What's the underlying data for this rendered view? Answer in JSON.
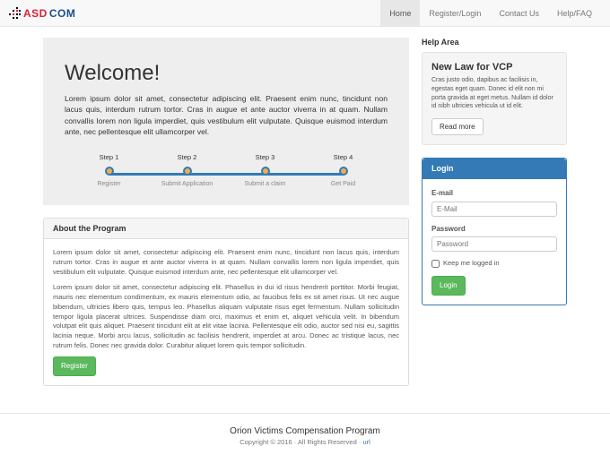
{
  "brand": {
    "part1": "ASD",
    "part2": "COM"
  },
  "nav": {
    "items": [
      {
        "label": "Home",
        "active": true
      },
      {
        "label": "Register/Login",
        "active": false
      },
      {
        "label": "Contact Us",
        "active": false
      },
      {
        "label": "Help/FAQ",
        "active": false
      }
    ]
  },
  "jumbo": {
    "title": "Welcome!",
    "body": "Lorem ipsum dolor sit amet, consectetur adipiscing elit. Praesent enim nunc, tincidunt non lacus quis, interdum rutrum tortor. Cras in augue et ante auctor viverra in at quam. Nullam convallis lorem non ligula imperdiet, quis vestibulum elit vulputate. Quisque euismod interdum ante, nec pellentesque elit ullamcorper vel."
  },
  "steps": [
    {
      "top": "Step 1",
      "bottom": "Register"
    },
    {
      "top": "Step 2",
      "bottom": "Submit Application"
    },
    {
      "top": "Step 3",
      "bottom": "Submit a claim"
    },
    {
      "top": "Step 4",
      "bottom": "Get Paid"
    }
  ],
  "about": {
    "heading": "About the Program",
    "p1": "Lorem ipsum dolor sit amet, consectetur adipiscing elit. Praesent enim nunc, tincidunt non lacus quis, interdum rutrum tortor. Cras in augue et ante auctor viverra in at quam. Nullam convallis lorem non ligula imperdiet, quis vestibulum elit vulputate. Quisque euismod interdum ante, nec pellentesque elit ullamcorper vel.",
    "p2": "Lorem ipsum dolor sit amet, consectetur adipiscing elit. Phasellus in dui id risus hendrerit porttitor. Morbi feugiat, mauris nec elementum condimentum, ex mauris elementum odio, ac faucibus felis ex sit amet risus. Ut nec augue bibendum, ultricies libero quis, tempus leo. Phasellus aliquam vulputate risus eget fermentum. Nullam sollicitudin tempor ligula placerat ultrices. Suspendisse diam orci, maximus et enim et, aliquet vehicula velit. In bibendum volutpat elit quis aliquet. Praesent tincidunt elit at elit vitae lacinia. Pellentesque elit odio, auctor sed nisi eu, sagittis lacinia neque. Morbi arcu lacus, sollicitudin ac facilisis hendrerit, imperdiet at arcu. Donec ac tristique lacus, nec rutrum felis. Donec nec gravida dolor. Curabitur aliquet lorem quis tempor sollicitudin.",
    "register_btn": "Register"
  },
  "help": {
    "area_label": "Help Area",
    "news_title": "New Law for VCP",
    "news_body": "Cras justo odio, dapibus ac facilisis in, egestas eget quam. Donec id elit non mi porta gravida at eget metus. Nullam id dolor id nibh ultricies vehicula ut id elit.",
    "read_more": "Read more"
  },
  "login": {
    "heading": "Login",
    "email_label": "E-mail",
    "email_placeholder": "E-Mail",
    "password_label": "Password",
    "password_placeholder": "Password",
    "remember": "Keep me logged in",
    "submit": "Login"
  },
  "footer": {
    "program": "Orion Victims Compensation Program",
    "copyright": "Copyright © 2016 · All Rights Reserved · ",
    "url": "url"
  }
}
